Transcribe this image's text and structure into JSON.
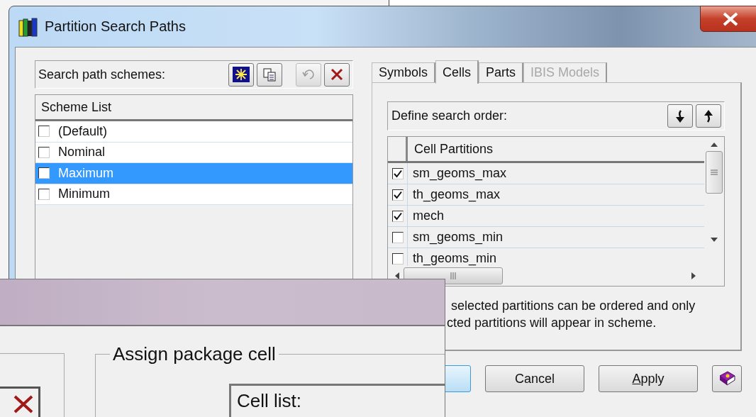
{
  "back_window": {
    "title": "Partition Search Paths",
    "schemes": {
      "label": "Search path schemes:",
      "column": "Scheme List",
      "items": [
        {
          "name": "(Default)",
          "checked": false,
          "selected": false
        },
        {
          "name": "Nominal",
          "checked": false,
          "selected": false
        },
        {
          "name": "Maximum",
          "checked": false,
          "selected": true
        },
        {
          "name": "Minimum",
          "checked": false,
          "selected": false
        }
      ]
    },
    "tabs": [
      {
        "label": "Symbols",
        "selected": false,
        "disabled": false
      },
      {
        "label": "Cells",
        "selected": true,
        "disabled": false
      },
      {
        "label": "Parts",
        "selected": false,
        "disabled": false
      },
      {
        "label": "IBIS Models",
        "selected": false,
        "disabled": true
      }
    ],
    "order": {
      "label": "Define search order:",
      "column": "Cell Partitions",
      "rows": [
        {
          "name": "sm_geoms_max",
          "checked": true
        },
        {
          "name": "th_geoms_max",
          "checked": true
        },
        {
          "name": "mech",
          "checked": true
        },
        {
          "name": "sm_geoms_min",
          "checked": false
        },
        {
          "name": "th_geoms_min",
          "checked": false
        }
      ]
    },
    "note_lines": [
      "selected partitions can be ordered and only",
      "cted partitions will appear in scheme."
    ],
    "buttons": [
      {
        "kind": "default"
      },
      {
        "kind": "text",
        "label": "Cancel",
        "access_key": false
      },
      {
        "kind": "text",
        "label": "Apply",
        "access_key": true
      },
      {
        "kind": "help"
      }
    ]
  },
  "front_window": {
    "group_title": "Assign package cell",
    "cell_list_label": "Cell list:"
  }
}
